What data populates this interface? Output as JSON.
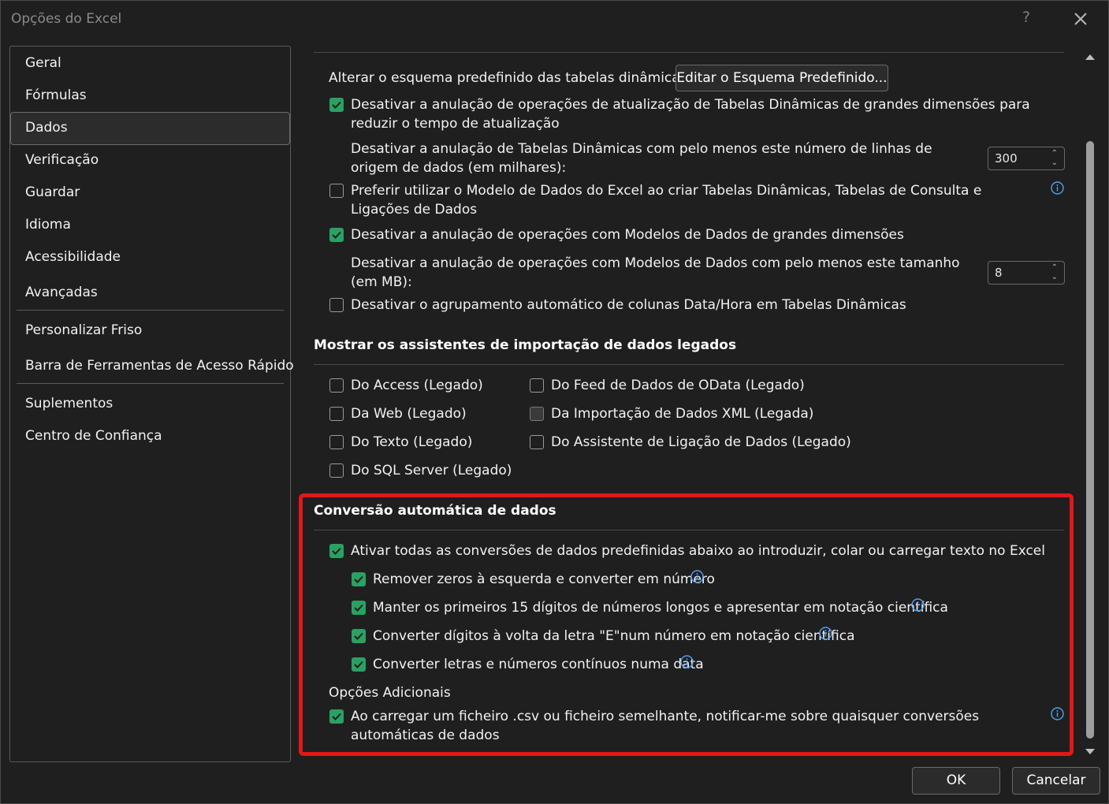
{
  "window": {
    "title": "Opções do Excel",
    "help_icon": "?"
  },
  "sidebar": {
    "items": [
      {
        "label": "Geral"
      },
      {
        "label": "Fórmulas"
      },
      {
        "label": "Dados",
        "selected": true
      },
      {
        "label": "Verificação"
      },
      {
        "label": "Guardar"
      },
      {
        "label": "Idioma"
      },
      {
        "label": "Acessibilidade"
      },
      {
        "label": "Avançadas"
      },
      {
        "label": "Personalizar Friso"
      },
      {
        "label": "Barra de Ferramentas de Acesso Rápido"
      },
      {
        "label": "Suplementos"
      },
      {
        "label": "Centro de Confiança"
      }
    ]
  },
  "pivot": {
    "default_layout_label": "Alterar o esquema predefinido das tabelas dinâmicas:",
    "edit_layout_button": "Editar o Esquema Predefinido...",
    "disable_undo_large_pivot": {
      "label": "Desativar a anulação de operações de atualização de Tabelas Dinâmicas de grandes dimensões para reduzir o tempo de atualização",
      "checked": true
    },
    "disable_undo_rows_label": "Desativar a anulação de Tabelas Dinâmicas com pelo menos este número de linhas de origem de dados (em milhares):",
    "disable_undo_rows_value": "300",
    "prefer_data_model": {
      "label": "Preferir utilizar o Modelo de Dados do Excel ao criar Tabelas Dinâmicas, Tabelas de Consulta e Ligações de Dados",
      "checked": false
    },
    "disable_undo_data_model": {
      "label": "Desativar a anulação de operações com Modelos de Dados de grandes dimensões",
      "checked": true
    },
    "disable_undo_mb_label": "Desativar a anulação de operações com Modelos de Dados com pelo menos este tamanho (em MB):",
    "disable_undo_mb_value": "8",
    "disable_auto_grouping": {
      "label": "Desativar o agrupamento automático de colunas Data/Hora em Tabelas Dinâmicas",
      "checked": false
    }
  },
  "legacy": {
    "title": "Mostrar os assistentes de importação de dados legados",
    "access": {
      "label": "Do Access (Legado)",
      "checked": false
    },
    "web": {
      "label": "Da Web (Legado)",
      "checked": false
    },
    "text": {
      "label": "Do Texto (Legado)",
      "checked": false
    },
    "sql": {
      "label": "Do SQL Server (Legado)",
      "checked": false
    },
    "odata": {
      "label": "Do Feed de Dados de OData (Legado)",
      "checked": false
    },
    "xml": {
      "label": "Da Importação de Dados XML (Legada)",
      "checked": false
    },
    "wizard": {
      "label": "Do Assistente de Ligação de Dados (Legado)",
      "checked": false
    }
  },
  "conversion": {
    "title": "Conversão automática de dados",
    "enable_all": {
      "label": "Ativar todas as conversões de dados predefinidas abaixo ao introduzir, colar ou carregar texto no Excel",
      "checked": true
    },
    "leading_zeros": {
      "label": "Remover zeros à esquerda e converter em número",
      "checked": true
    },
    "first_15": {
      "label": "Manter os primeiros 15 dígitos de números longos e apresentar em notação científica",
      "checked": true
    },
    "letter_e": {
      "label": "Converter dígitos à volta da letra \"E\"num número em notação científica",
      "checked": true
    },
    "to_date": {
      "label": "Converter letras e números contínuos numa data",
      "checked": true
    },
    "additional_title": "Opções Adicionais",
    "notify_csv": {
      "label": "Ao carregar um ficheiro .csv ou ficheiro semelhante, notificar-me sobre quaisquer conversões automáticas de dados",
      "checked": true
    }
  },
  "footer": {
    "ok": "OK",
    "cancel": "Cancelar"
  },
  "colors": {
    "accent_checkbox": "#2aa163",
    "highlight": "#e0181b",
    "info": "#4ea1f3",
    "background": "#1f1f1f"
  }
}
